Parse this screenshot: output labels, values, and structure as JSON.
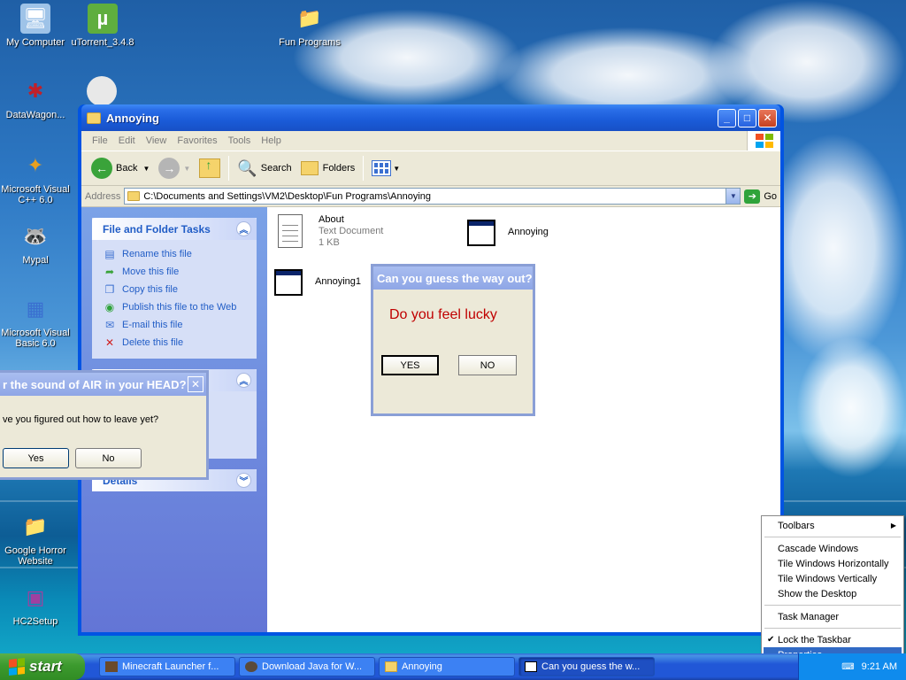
{
  "desktop": {
    "icons": [
      {
        "label": "My Computer",
        "glyph": "🖥"
      },
      {
        "label": "uTorrent_3.4.8",
        "glyph": "µ"
      },
      {
        "label": "Fun Programs",
        "glyph": "📁"
      },
      {
        "label": "DataWagon...",
        "glyph": "✱"
      },
      {
        "label": "Microsoft Visual C++ 6.0",
        "glyph": "✦"
      },
      {
        "label": "Mypal",
        "glyph": "🦝"
      },
      {
        "label": "Microsoft Visual Basic 6.0",
        "glyph": "▦"
      },
      {
        "label": "Google Horror Website",
        "glyph": "📁"
      },
      {
        "label": "HC2Setup",
        "glyph": "▣"
      }
    ]
  },
  "window": {
    "title": "Annoying",
    "menu": [
      "File",
      "Edit",
      "View",
      "Favorites",
      "Tools",
      "Help"
    ],
    "toolbar": {
      "back": "Back",
      "search": "Search",
      "folders": "Folders"
    },
    "address": {
      "label": "Address",
      "path": "C:\\Documents and Settings\\VM2\\Desktop\\Fun Programs\\Annoying",
      "go": "Go"
    },
    "taskpane": {
      "file_tasks_title": "File and Folder Tasks",
      "file_tasks": [
        {
          "label": "Rename this file",
          "icon": "rename-icon"
        },
        {
          "label": "Move this file",
          "icon": "move-icon"
        },
        {
          "label": "Copy this file",
          "icon": "copy-icon"
        },
        {
          "label": "Publish this file to the Web",
          "icon": "globe-icon"
        },
        {
          "label": "E-mail this file",
          "icon": "email-icon"
        },
        {
          "label": "Delete this file",
          "icon": "delete-icon"
        }
      ],
      "details_title": "Details"
    },
    "files": [
      {
        "name": "About",
        "type": "Text Document",
        "size": "1 KB"
      },
      {
        "name": "Annoying"
      },
      {
        "name": "Annoying1"
      }
    ]
  },
  "dialog_lucky": {
    "title": "Can you guess the way out?",
    "message": "Do you feel lucky",
    "yes": "YES",
    "no": "NO",
    "message_color": "#c00000"
  },
  "dialog_air": {
    "title": "r the sound of AIR in your HEAD?",
    "message": "ve you figured out how to leave yet?",
    "yes": "Yes",
    "no": "No"
  },
  "taskbar": {
    "start": "start",
    "items": [
      {
        "label": "Minecraft Launcher f..."
      },
      {
        "label": "Download Java for W..."
      },
      {
        "label": "Annoying"
      },
      {
        "label": "Can you guess the w..."
      }
    ],
    "clock": "9:21 AM"
  },
  "context_menu": {
    "toolbars": "Toolbars",
    "cascade": "Cascade Windows",
    "tile_h": "Tile Windows Horizontally",
    "tile_v": "Tile Windows Vertically",
    "show_desktop": "Show the Desktop",
    "task_manager": "Task Manager",
    "lock": "Lock the Taskbar",
    "properties": "Properties"
  }
}
